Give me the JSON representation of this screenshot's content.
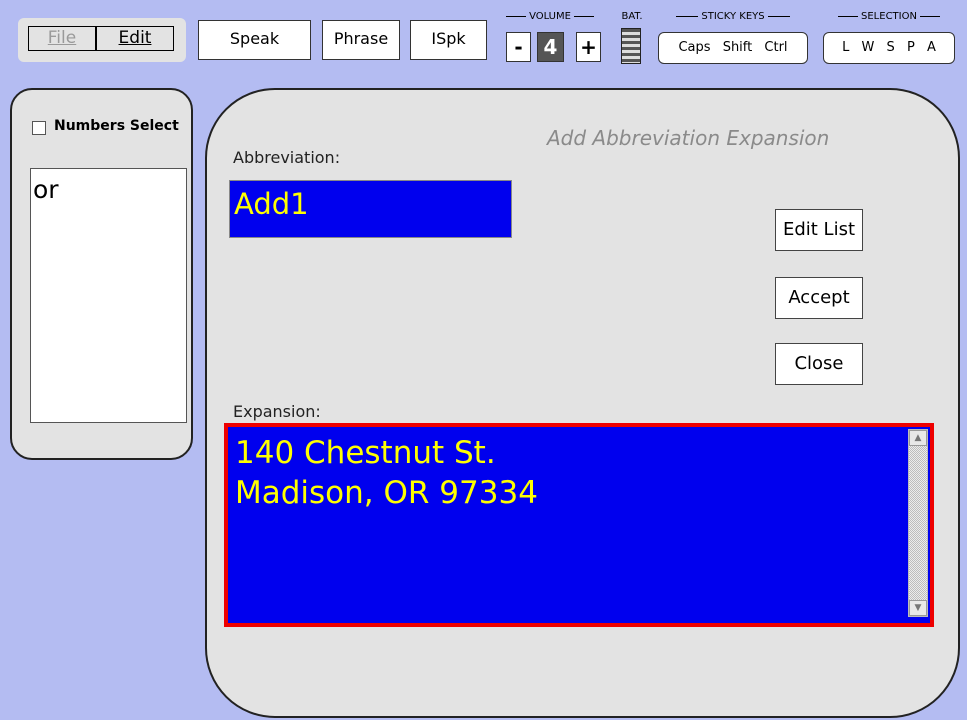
{
  "menu": {
    "file_label": "File",
    "edit_label": "Edit"
  },
  "toolbar": {
    "speak_label": "Speak",
    "phrase_label": "Phrase",
    "ispk_label": "ISpk"
  },
  "volume": {
    "group_label": "VOLUME",
    "minus_label": "-",
    "value": "4",
    "plus_label": "+"
  },
  "battery": {
    "group_label": "BAT."
  },
  "sticky_keys": {
    "group_label": "STICKY KEYS",
    "keys": [
      "Caps",
      "Shift",
      "Ctrl"
    ]
  },
  "selection": {
    "group_label": "SELECTION",
    "modes": [
      "L",
      "W",
      "S",
      "P",
      "A"
    ]
  },
  "left_panel": {
    "checkbox_label": "Numbers Select",
    "checked": false,
    "items": [
      "or"
    ]
  },
  "dialog": {
    "title": "Add Abbreviation Expansion",
    "abbreviation_label": "Abbreviation:",
    "abbreviation_value": "Add1",
    "expansion_label": "Expansion:",
    "expansion_value": "140 Chestnut St.\nMadison, OR 97334",
    "edit_list_label": "Edit List",
    "accept_label": "Accept",
    "close_label": "Close"
  },
  "colors": {
    "background": "#b4bcf2",
    "field_bg": "#0000ee",
    "field_text": "#ffff00",
    "focus_border": "#ee0000",
    "panel_bg": "#e3e3e3"
  }
}
